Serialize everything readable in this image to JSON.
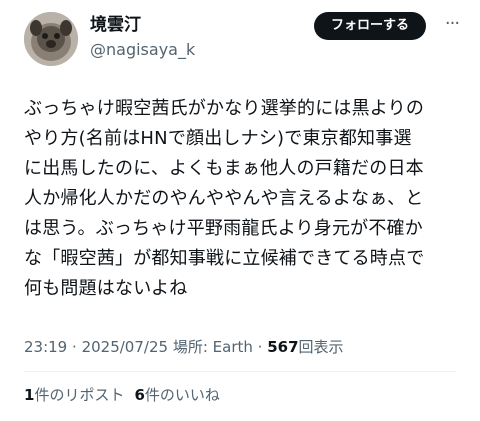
{
  "author": {
    "display_name": "境雲汀",
    "handle": "@nagisaya_k"
  },
  "actions": {
    "follow_label": "フォローする",
    "more_label": "···"
  },
  "tweet": {
    "lines": [
      "ぶっちゃけ暇空茜氏がかなり選挙的には黒よりの",
      "やり方(名前はHNで顔出しナシ)で東京都知事選",
      "に出馬したのに、よくもまぁ他人の戸籍だの日本",
      "人か帰化人かだのやんややんや言えるよなぁ、と",
      "は思う。ぶっちゃけ平野雨龍氏より身元が不確か",
      "な「暇空茜」が都知事戦に立候補できてる時点で",
      "何も問題はないよね"
    ]
  },
  "meta": {
    "time": "23:19",
    "separator": "·",
    "date": "2025/07/25",
    "location": "場所: Earth",
    "views_count": "567",
    "views_label": "回表示"
  },
  "stats": {
    "reposts_count": "1",
    "reposts_label": "件のリポスト",
    "likes_count": "6",
    "likes_label": "件のいいね"
  }
}
